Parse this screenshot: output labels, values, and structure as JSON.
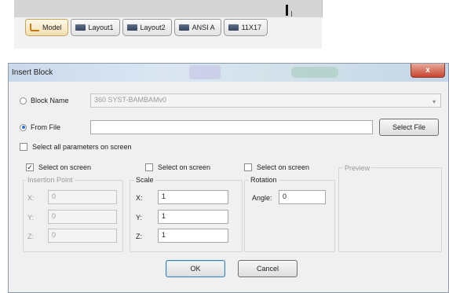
{
  "layout_tabs": [
    {
      "label": "Model",
      "icon": "model-icon"
    },
    {
      "label": "Layout1",
      "icon": "layout-icon"
    },
    {
      "label": "Layout2",
      "icon": "layout-icon"
    },
    {
      "label": "ANSI A",
      "icon": "layout-icon"
    },
    {
      "label": "11X17",
      "icon": "layout-icon"
    }
  ],
  "dialog": {
    "title": "Insert Block",
    "close_label": "x",
    "block_name": {
      "label": "Block Name",
      "value": "360 SYST-BAMBAMv0",
      "selected": false
    },
    "from_file": {
      "label": "From File",
      "value": "",
      "selected": true,
      "button": "Select File"
    },
    "select_all": {
      "label": "Select all parameters on screen",
      "checked": false
    },
    "insertion": {
      "select_label": "Select on screen",
      "checked": true,
      "group_label": "Insertion Point",
      "x_label": "X:",
      "x": "0",
      "y_label": "Y:",
      "y": "0",
      "z_label": "Z:",
      "z": "0"
    },
    "scale": {
      "select_label": "Select on screen",
      "checked": false,
      "group_label": "Scale",
      "x_label": "X:",
      "x": "1",
      "y_label": "Y:",
      "y": "1",
      "z_label": "Z:",
      "z": "1"
    },
    "rotation": {
      "select_label": "Select on screen",
      "checked": false,
      "group_label": "Rotation",
      "angle_label": "Angle:",
      "angle": "0"
    },
    "preview_label": "Preview",
    "ok_label": "OK",
    "cancel_label": "Cancel"
  },
  "colors": {
    "accent": "#2f6fd1",
    "title_bar": "#c9d9ec",
    "close_button": "#c6452f"
  }
}
